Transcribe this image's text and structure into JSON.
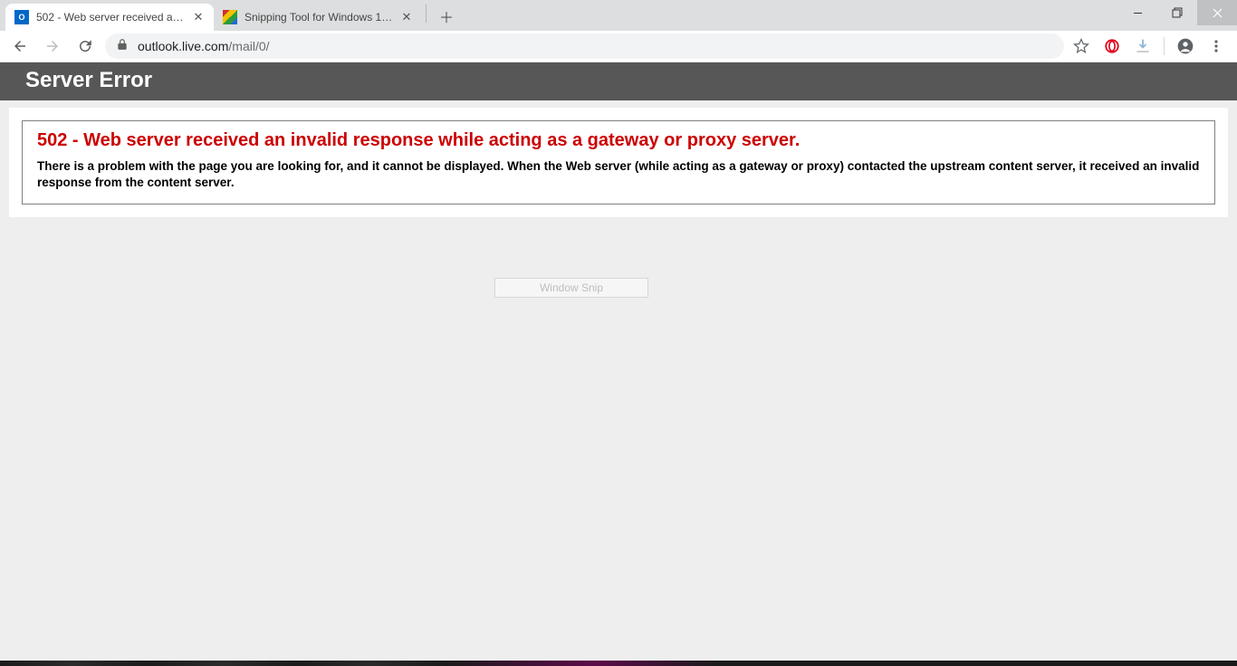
{
  "tabs": [
    {
      "title": "502 - Web server received an inv",
      "active": true,
      "favicon": "outlook"
    },
    {
      "title": "Snipping Tool for Windows 10/8",
      "active": false,
      "favicon": "snip"
    }
  ],
  "omnibox": {
    "host": "outlook.live.com",
    "path": "/mail/0/"
  },
  "page": {
    "header": "Server Error",
    "error_title": "502 - Web server received an invalid response while acting as a gateway or proxy server.",
    "error_desc": "There is a problem with the page you are looking for, and it cannot be displayed. When the Web server (while acting as a gateway or proxy) contacted the upstream content server, it received an invalid response from the content server."
  },
  "overlay": {
    "snip_label": "Window Snip"
  }
}
